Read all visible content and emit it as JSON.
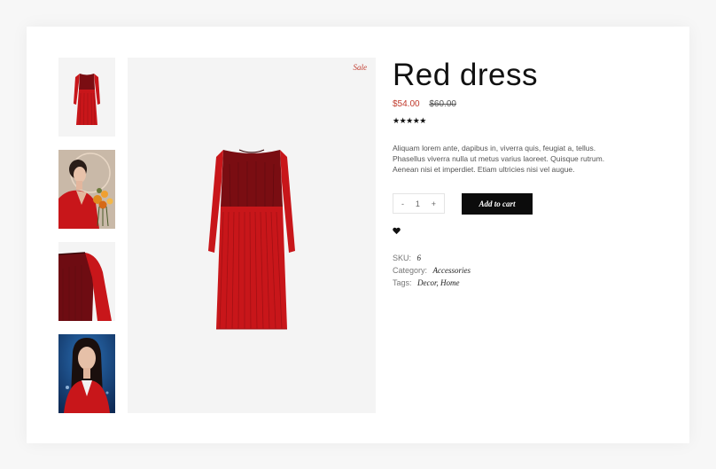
{
  "product": {
    "title": "Red dress",
    "sale_badge": "Sale",
    "price_current": "$54.00",
    "price_original": "$60.00",
    "rating_stars": "★★★★★",
    "description": "Aliquam lorem ante, dapibus in, viverra quis, feugiat a, tellus. Phasellus viverra nulla ut metus varius laoreet. Quisque rutrum. Aenean nisi et imperdiet. Etiam ultricies nisi vel augue."
  },
  "cart": {
    "minus": "-",
    "quantity": "1",
    "plus": "+",
    "add_to_cart_label": "Add to cart"
  },
  "meta": {
    "sku_label": "SKU:",
    "sku_value": "6",
    "category_label": "Category:",
    "category_value": "Accessories",
    "tags_label": "Tags:",
    "tags": [
      "Decor",
      "Home"
    ]
  },
  "colors": {
    "accent_red": "#c0392b",
    "dress_red": "#c8161a",
    "button_black": "#0c0c0c"
  },
  "icons": [
    "heart-icon"
  ]
}
